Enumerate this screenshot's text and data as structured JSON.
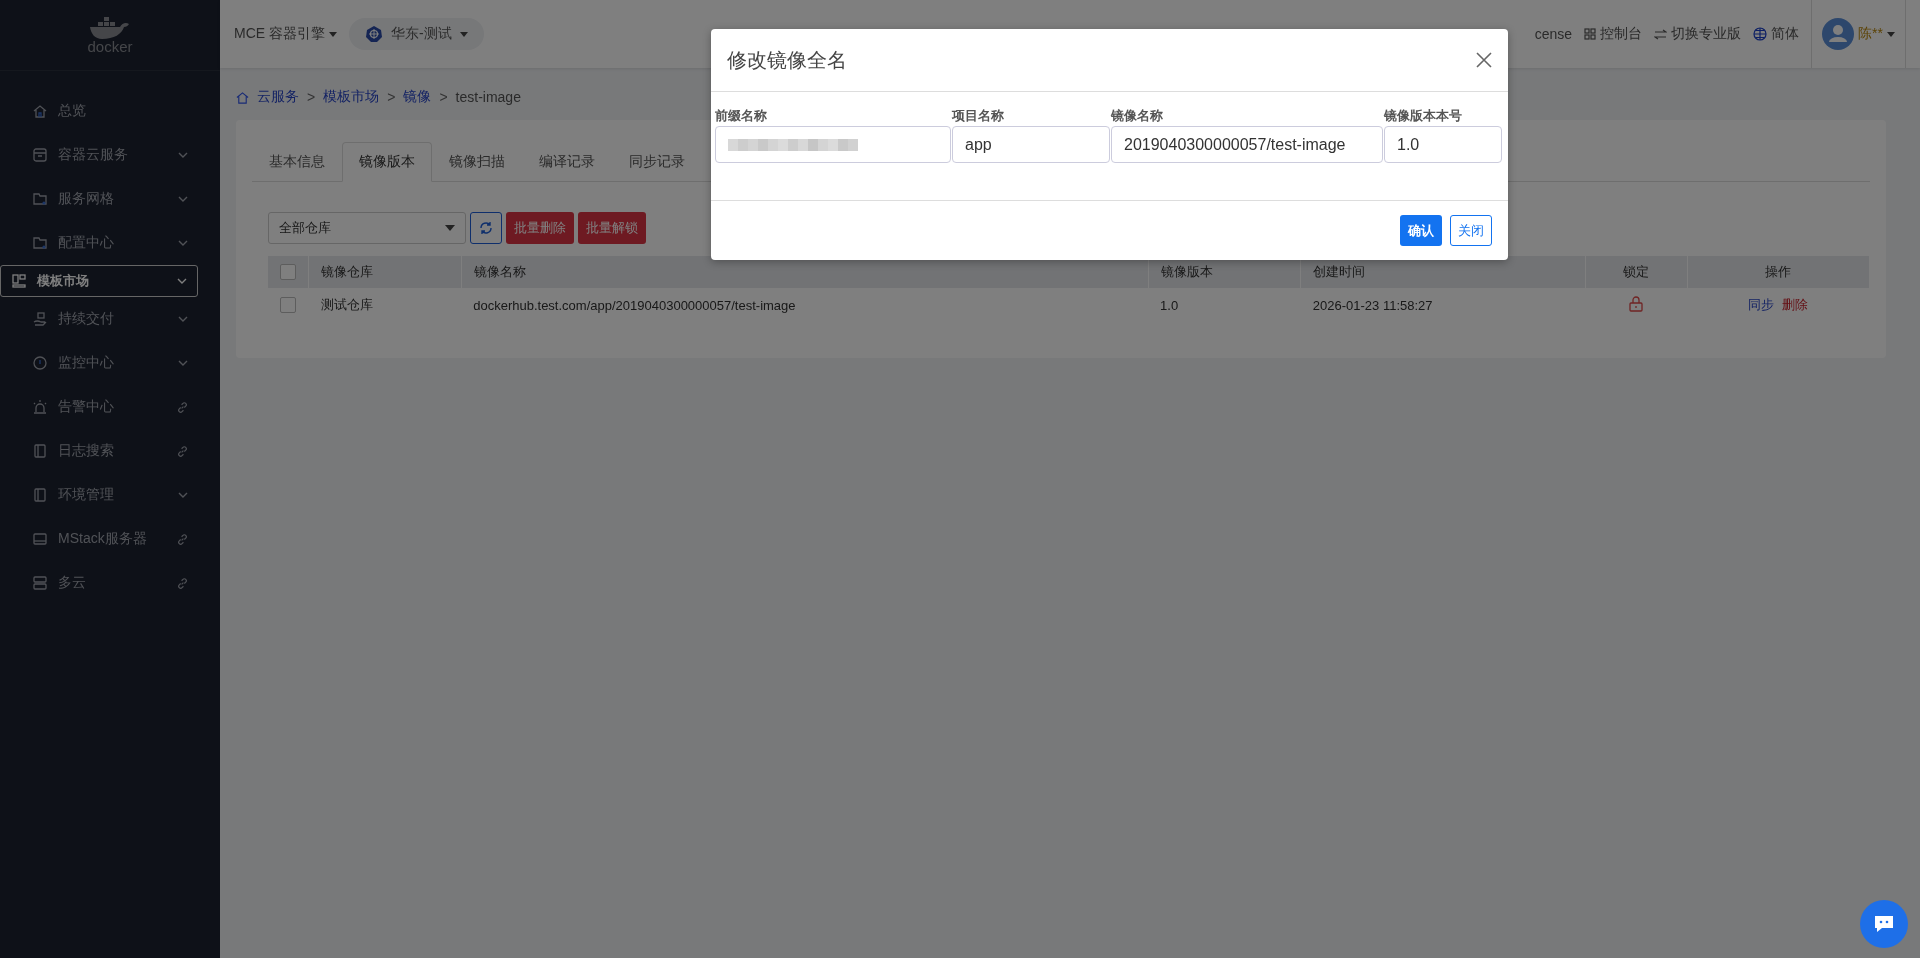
{
  "sidebar": {
    "logo": "docker",
    "items": [
      {
        "label": "总览",
        "kind": "plain",
        "selected": false
      },
      {
        "label": "容器云服务",
        "kind": "expand",
        "selected": false
      },
      {
        "label": "服务网格",
        "kind": "expand",
        "selected": false
      },
      {
        "label": "配置中心",
        "kind": "expand",
        "selected": false
      },
      {
        "label": "模板市场",
        "kind": "expand",
        "selected": true
      },
      {
        "label": "持续交付",
        "kind": "expand",
        "selected": false
      },
      {
        "label": "监控中心",
        "kind": "expand",
        "selected": false
      },
      {
        "label": "告警中心",
        "kind": "link",
        "selected": false
      },
      {
        "label": "日志搜索",
        "kind": "link",
        "selected": false
      },
      {
        "label": "环境管理",
        "kind": "expand",
        "selected": false
      },
      {
        "label": "MStack服务器",
        "kind": "link",
        "selected": false
      },
      {
        "label": "多云",
        "kind": "link",
        "selected": false
      }
    ]
  },
  "topbar": {
    "product": "MCE 容器引擎",
    "cluster": "华东-测试",
    "links": [
      {
        "label": "cense"
      },
      {
        "label": "控制台"
      },
      {
        "label": "切换专业版"
      },
      {
        "label": "简体"
      }
    ],
    "user": "陈**"
  },
  "breadcrumb": [
    {
      "label": "云服务",
      "kind": "link"
    },
    {
      "label": ">",
      "kind": "separator"
    },
    {
      "label": "模板市场",
      "kind": "link"
    },
    {
      "label": ">",
      "kind": "separator"
    },
    {
      "label": "镜像",
      "kind": "link"
    },
    {
      "label": ">",
      "kind": "separator"
    },
    {
      "label": "test-image",
      "kind": "current"
    }
  ],
  "tabs": [
    {
      "label": "基本信息",
      "selected": false
    },
    {
      "label": "镜像版本",
      "selected": true
    },
    {
      "label": "镜像扫描",
      "selected": false
    },
    {
      "label": "编译记录",
      "selected": false
    },
    {
      "label": "同步记录",
      "selected": false
    }
  ],
  "toolbar": {
    "repo_select": "全部仓库",
    "buttons": [
      "批量删除",
      "批量解锁"
    ]
  },
  "table": {
    "header_checked": false,
    "columns": [
      "镜像仓库",
      "镜像名称",
      "镜像版本",
      "创建时间",
      "锁定",
      "操作"
    ],
    "rows": [
      {
        "checked": false,
        "repo": "测试仓库",
        "name": "dockerhub.test.com/app/2019040300000057/test-image",
        "version": "1.0",
        "created": "2026-01-23 11:58:27",
        "locked": true,
        "actions": [
          "同步",
          "删除"
        ]
      }
    ]
  },
  "dialog": {
    "title": "修改镜像全名",
    "fields": [
      {
        "label": "前缀名称",
        "kind": "redacted"
      },
      {
        "label": "项目名称",
        "kind": "text",
        "value": "app"
      },
      {
        "label": "镜像名称",
        "kind": "text",
        "value": "2019040300000057/test-image"
      },
      {
        "label": "镜像版本本号",
        "kind": "text",
        "value": "1.0"
      }
    ],
    "confirm": "确认",
    "close": "关闭"
  }
}
